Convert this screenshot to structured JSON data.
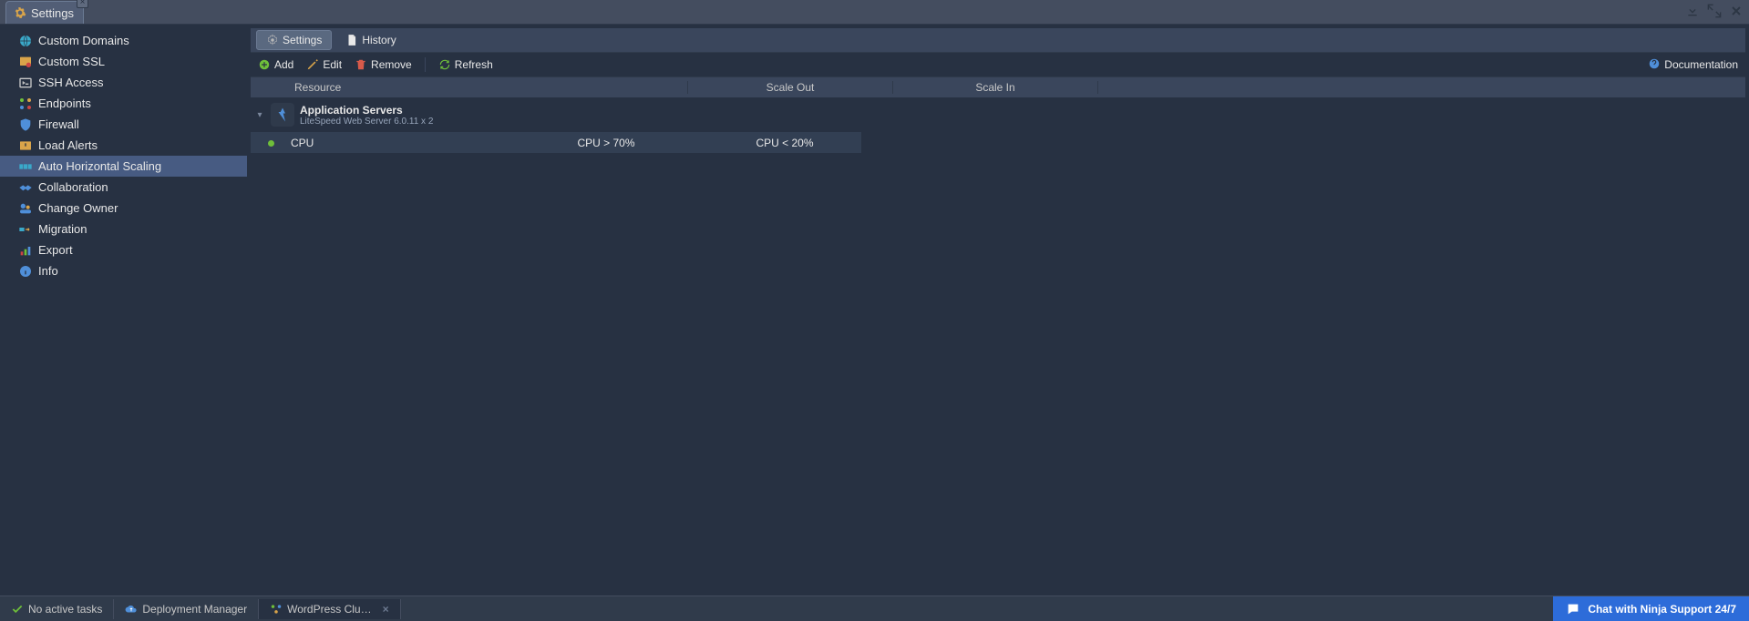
{
  "top_tab": {
    "label": "Settings"
  },
  "sidebar": {
    "items": [
      {
        "label": "Custom Domains"
      },
      {
        "label": "Custom SSL"
      },
      {
        "label": "SSH Access"
      },
      {
        "label": "Endpoints"
      },
      {
        "label": "Firewall"
      },
      {
        "label": "Load Alerts"
      },
      {
        "label": "Auto Horizontal Scaling"
      },
      {
        "label": "Collaboration"
      },
      {
        "label": "Change Owner"
      },
      {
        "label": "Migration"
      },
      {
        "label": "Export"
      },
      {
        "label": "Info"
      }
    ]
  },
  "subtabs": {
    "settings": "Settings",
    "history": "History"
  },
  "toolbar": {
    "add": "Add",
    "edit": "Edit",
    "remove": "Remove",
    "refresh": "Refresh",
    "doc": "Documentation"
  },
  "grid": {
    "headers": {
      "resource": "Resource",
      "scale_out": "Scale Out",
      "scale_in": "Scale In"
    },
    "group": {
      "title": "Application Servers",
      "subtitle": "LiteSpeed Web Server 6.0.11 x 2"
    },
    "row": {
      "resource": "CPU",
      "scale_out": "CPU > 70%",
      "scale_in": "CPU < 20%"
    }
  },
  "footer": {
    "tasks": "No active tasks",
    "deployment": "Deployment Manager",
    "wp": "WordPress Clu…",
    "chat": "Chat with Ninja Support 24/7"
  }
}
